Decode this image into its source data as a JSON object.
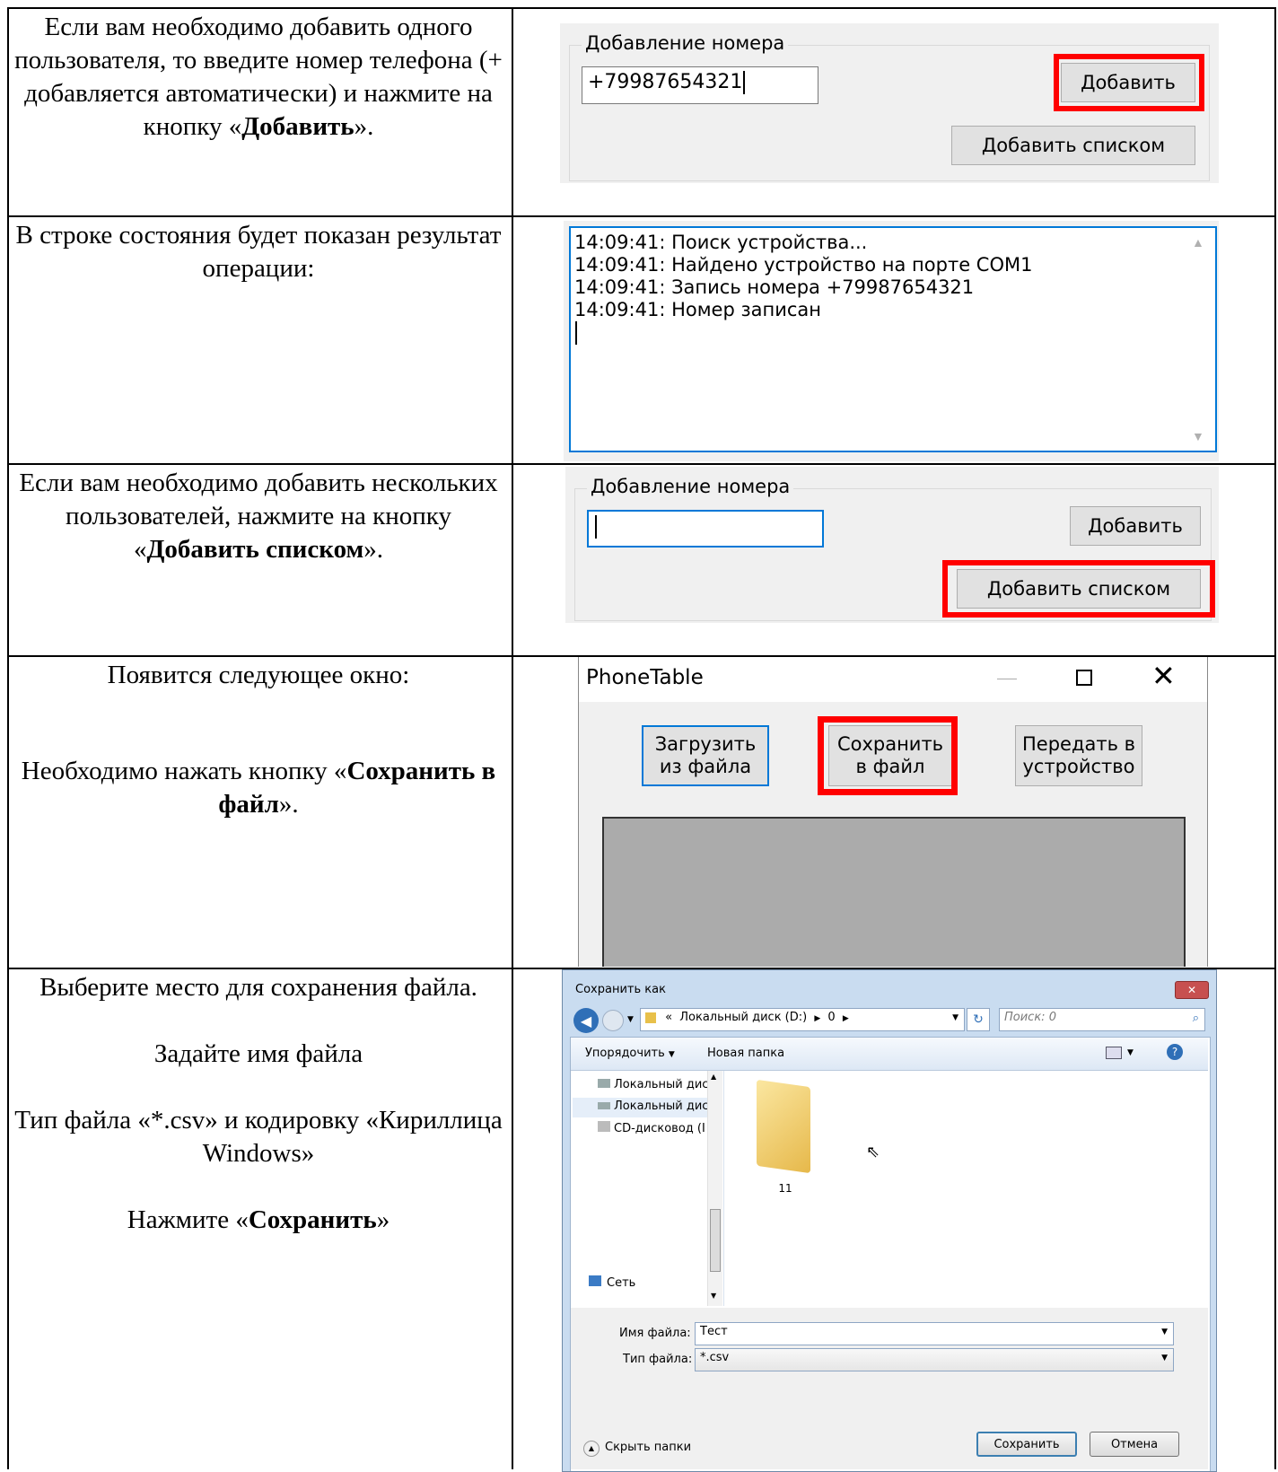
{
  "rows": [
    {
      "text_parts": [
        {
          "t": "Если вам необходимо добавить одного пользователя, то введите номер телефона (+ добавляется автоматически) и нажмите на кнопку «"
        },
        {
          "b": "Добавить"
        },
        {
          "t": "»."
        }
      ]
    },
    {
      "text_parts": [
        {
          "t": "В строке состояния будет показан результат операции:"
        }
      ]
    },
    {
      "text_parts": [
        {
          "t": "Если вам необходимо добавить нескольких пользователей, нажмите на кнопку «"
        },
        {
          "b": "Добавить списком"
        },
        {
          "t": "»."
        }
      ]
    },
    {
      "line1": "Появится следующее окно:",
      "text_parts": [
        {
          "t": "Необходимо нажать кнопку «"
        },
        {
          "b": "Сохранить в файл"
        },
        {
          "t": "»."
        }
      ]
    },
    {
      "p1": "Выберите место для сохранения файла.",
      "p2": "Задайте имя файла",
      "p3": "Тип файла «*.csv» и кодировку «Кириллица Windows»",
      "p4_pre": "Нажмите «",
      "p4_bold": "Сохранить",
      "p4_post": "»"
    }
  ],
  "add_panel_1": {
    "group_title": "Добавление номера",
    "phone_value": "+79987654321",
    "add_button": "Добавить",
    "add_list_button": "Добавить списком"
  },
  "log": {
    "lines": [
      "14:09:41: Поиск устройства...",
      "14:09:41: Найдено устройство на порте COM1",
      "14:09:41: Запись номера +79987654321",
      "14:09:41: Номер записан"
    ]
  },
  "add_panel_2": {
    "group_title": "Добавление номера",
    "phone_value": "",
    "add_button": "Добавить",
    "add_list_button": "Добавить списком"
  },
  "phonetable": {
    "title": "PhoneTable",
    "load_button": "Загрузить\nиз файла",
    "save_button": "Сохранить\nв файл",
    "send_button": "Передать в\nустройство"
  },
  "save_dialog": {
    "title": "Сохранить как",
    "path_prefix": "«",
    "path_drive": "Локальный диск (D:)",
    "path_folder": "0",
    "search_placeholder": "Поиск: 0",
    "organize": "Упорядочить",
    "new_folder": "Новая папка",
    "nav_items": [
      "Локальный дис",
      "Локальный дис",
      "CD-дисковод (I"
    ],
    "network": "Сеть",
    "folder_name": "11",
    "filename_label": "Имя файла:",
    "filename_value": "Тест",
    "filetype_label": "Тип файла:",
    "filetype_value": "*.csv",
    "hide_folders": "Скрыть папки",
    "save_button": "Сохранить",
    "cancel_button": "Отмена"
  },
  "colors": {
    "highlight": "#ff0000",
    "focus_blue": "#0078d7"
  }
}
